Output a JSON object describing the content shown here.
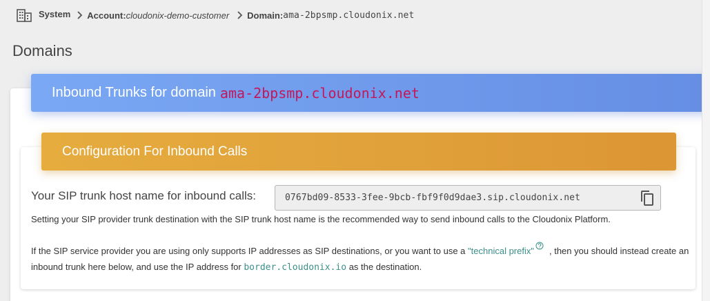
{
  "breadcrumb": {
    "home_icon": "building-icon",
    "system_label": "System",
    "account_key": "Account:",
    "account_value": "cloudonix-demo-customer",
    "domain_key": "Domain:",
    "domain_value": "ama-2bpsmp.cloudonix.net"
  },
  "page": {
    "title": "Domains"
  },
  "inbound_trunks": {
    "header_prefix": "Inbound Trunks for domain",
    "header_domain": "ama-2bpsmp.cloudonix.net"
  },
  "config": {
    "header": "Configuration For Inbound Calls",
    "host_label": "Your SIP trunk host name for inbound calls:",
    "host_value": "0767bd09-8533-3fee-9bcb-fbf9f0d9dae3.sip.cloudonix.net",
    "copy_icon": "copy-icon",
    "description1": "Setting your SIP provider trunk destination with the SIP trunk host name is the recommended way to send inbound calls to the Cloudonix Platform.",
    "description2_part1": "If the SIP service provider you are using only supports IP addresses as SIP destinations, or you want to use a ",
    "description2_link": "\"technical prefix\"",
    "description2_part2": ", then you should instead create an inbound trunk here below, and use the IP address for ",
    "description2_code": "border.cloudonix.io",
    "description2_part3": " as the destination."
  },
  "colors": {
    "blue_header": "#6e98ea",
    "orange_header": "#e1a23b",
    "domain_accent": "#c2185b",
    "link": "#3a8f8a"
  }
}
